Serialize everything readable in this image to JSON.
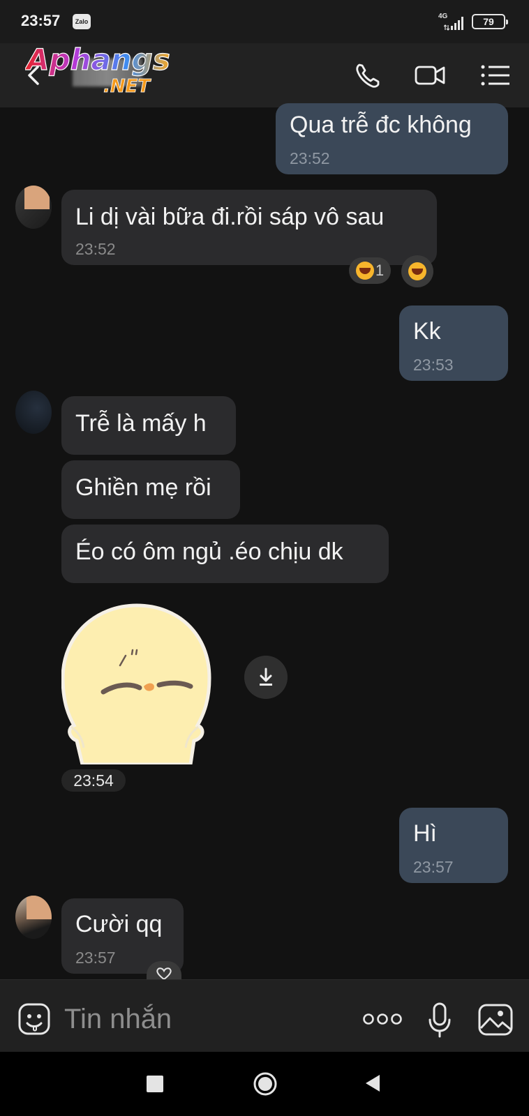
{
  "status_bar": {
    "time": "23:57",
    "app_badge": "Zalo",
    "network": "4G",
    "battery": "79"
  },
  "header": {
    "watermark_line1": "Aphangs",
    "watermark_line2": ".NET",
    "icons": [
      "back-icon",
      "phone-icon",
      "video-call-icon",
      "menu-list-icon"
    ]
  },
  "messages": [
    {
      "direction": "outgoing",
      "text": "Qua trễ đc không",
      "time": "23:52"
    },
    {
      "direction": "incoming",
      "text": "Li dị vài bữa đi.rồi sáp vô sau",
      "time": "23:52",
      "reaction_count": "1"
    },
    {
      "direction": "outgoing",
      "text": "Kk",
      "time": "23:53"
    },
    {
      "direction": "incoming",
      "text": "Trễ là mấy h"
    },
    {
      "direction": "incoming",
      "text": "Ghiền mẹ rồi"
    },
    {
      "direction": "incoming",
      "text": "Éo có ôm ngủ .éo chịu dk"
    },
    {
      "direction": "incoming",
      "type": "sticker",
      "time": "23:54"
    },
    {
      "direction": "outgoing",
      "text": "Hì",
      "time": "23:57"
    },
    {
      "direction": "incoming",
      "text": "Cười qq",
      "time": "23:57"
    }
  ],
  "input": {
    "placeholder": "Tin nhắn",
    "value": ""
  },
  "colors": {
    "background": "#121212",
    "incoming_bubble": "#2b2b2d",
    "outgoing_bubble": "#3b4858"
  }
}
